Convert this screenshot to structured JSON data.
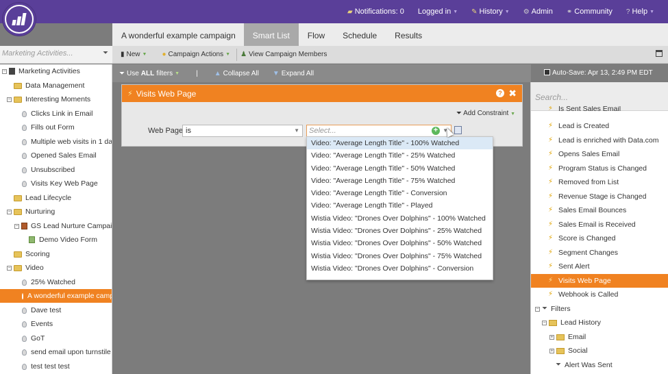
{
  "topnav": {
    "notifications": "Notifications: 0",
    "logged_in": "Logged in",
    "history": "History",
    "admin": "Admin",
    "community": "Community",
    "help": "Help"
  },
  "tabs": [
    {
      "label": "A wonderful example campaign"
    },
    {
      "label": "Smart List"
    },
    {
      "label": "Flow"
    },
    {
      "label": "Schedule"
    },
    {
      "label": "Results"
    }
  ],
  "left_search": {
    "placeholder": "Marketing Activities..."
  },
  "toolbar": {
    "new_label": "New",
    "campaign_actions_label": "Campaign Actions",
    "view_members_label": "View Campaign Members"
  },
  "filterbar": {
    "use_prefix": "Use",
    "use_bold": "ALL",
    "use_suffix": "filters",
    "separator": "|",
    "collapse_all": "Collapse All",
    "expand_all": "Expand All",
    "autosave": "Auto-Save: Apr 13, 2:49 PM EDT"
  },
  "tree": [
    {
      "label": "Marketing Activities"
    },
    {
      "label": "Data Management"
    },
    {
      "label": "Interesting Moments"
    },
    {
      "label": "Clicks Link in Email"
    },
    {
      "label": "Fills out Form"
    },
    {
      "label": "Multiple web visits in 1 day"
    },
    {
      "label": "Opened Sales Email"
    },
    {
      "label": "Unsubscribed"
    },
    {
      "label": "Visits Key Web Page"
    },
    {
      "label": "Lead Lifecycle"
    },
    {
      "label": "Nurturing"
    },
    {
      "label": "GS Lead Nurture Campaign"
    },
    {
      "label": "Demo Video Form"
    },
    {
      "label": "Scoring"
    },
    {
      "label": "Video"
    },
    {
      "label": "25% Watched"
    },
    {
      "label": "A wonderful example campaign"
    },
    {
      "label": "Dave test"
    },
    {
      "label": "Events"
    },
    {
      "label": "GoT"
    },
    {
      "label": "send email upon turnstile"
    },
    {
      "label": "test test test"
    }
  ],
  "filter_panel": {
    "title": "Visits Web Page",
    "help": "?",
    "close": "✖",
    "add_constraint": "Add Constraint",
    "field_label": "Web Page:",
    "operator": "is",
    "value_placeholder": "Select..."
  },
  "dropdown_options": [
    "Video: \"Average Length Title\" - 100% Watched",
    "Video: \"Average Length Title\" - 25% Watched",
    "Video: \"Average Length Title\" - 50% Watched",
    "Video: \"Average Length Title\" - 75% Watched",
    "Video: \"Average Length Title\" - Conversion",
    "Video: \"Average Length Title\" - Played",
    "Wistia Video: \"Drones Over Dolphins\" - 100% Watched",
    "Wistia Video: \"Drones Over Dolphins\" - 25% Watched",
    "Wistia Video: \"Drones Over Dolphins\" - 50% Watched",
    "Wistia Video: \"Drones Over Dolphins\" - 75% Watched",
    "Wistia Video: \"Drones Over Dolphins\" - Conversion"
  ],
  "right_search": {
    "placeholder": "Search..."
  },
  "right_items": [
    {
      "label": "Is Sent Sales Email"
    },
    {
      "label": "Lead is Created"
    },
    {
      "label": "Lead is enriched with Data.com"
    },
    {
      "label": "Opens Sales Email"
    },
    {
      "label": "Program Status is Changed"
    },
    {
      "label": "Removed from List"
    },
    {
      "label": "Revenue Stage is Changed"
    },
    {
      "label": "Sales Email Bounces"
    },
    {
      "label": "Sales Email is Received"
    },
    {
      "label": "Score is Changed"
    },
    {
      "label": "Segment Changes"
    },
    {
      "label": "Sent Alert"
    },
    {
      "label": "Visits Web Page"
    },
    {
      "label": "Webhook is Called"
    },
    {
      "label": "Filters"
    },
    {
      "label": "Lead History"
    },
    {
      "label": "Email"
    },
    {
      "label": "Social"
    },
    {
      "label": "Alert Was Sent"
    }
  ],
  "colors": {
    "header": "#5a3f99",
    "accent": "#f08221",
    "selected_option": "#dbe9f6"
  }
}
